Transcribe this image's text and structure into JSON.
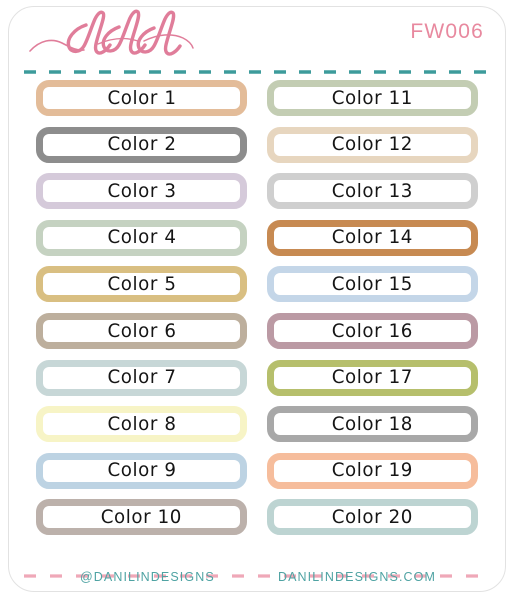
{
  "sheet": {
    "code": "FW006",
    "logo_name": "dld"
  },
  "dividers": {
    "top_color": "#3d9b9b",
    "bottom_color": "#efa8b8"
  },
  "footer": {
    "handle": "@DANILINDESIGNS",
    "website": "DANILINDESIGNS.COM",
    "text_color": "#4fa3a3"
  },
  "labels": {
    "left_column": [
      {
        "text": "Color 1",
        "color": "#e3bc99"
      },
      {
        "text": "Color 2",
        "color": "#8d8d8d"
      },
      {
        "text": "Color 3",
        "color": "#d5cada"
      },
      {
        "text": "Color 4",
        "color": "#c5d2c1"
      },
      {
        "text": "Color 5",
        "color": "#d9bf82"
      },
      {
        "text": "Color 6",
        "color": "#bdaf9d"
      },
      {
        "text": "Color 7",
        "color": "#c7d7d7"
      },
      {
        "text": "Color 8",
        "color": "#f7f4c6"
      },
      {
        "text": "Color 9",
        "color": "#bdd3e3"
      },
      {
        "text": "Color 10",
        "color": "#bcb1ab"
      }
    ],
    "right_column": [
      {
        "text": "Color 11",
        "color": "#c3cdb3"
      },
      {
        "text": "Color 12",
        "color": "#e7d6bf"
      },
      {
        "text": "Color 13",
        "color": "#cfcfcf"
      },
      {
        "text": "Color 14",
        "color": "#c78a52"
      },
      {
        "text": "Color 15",
        "color": "#c4d6e8"
      },
      {
        "text": "Color 16",
        "color": "#bb9aa4"
      },
      {
        "text": "Color 17",
        "color": "#b6bf6c"
      },
      {
        "text": "Color 18",
        "color": "#a8a8a8"
      },
      {
        "text": "Color 19",
        "color": "#f6bd9c"
      },
      {
        "text": "Color 20",
        "color": "#bdd4d2"
      }
    ]
  }
}
